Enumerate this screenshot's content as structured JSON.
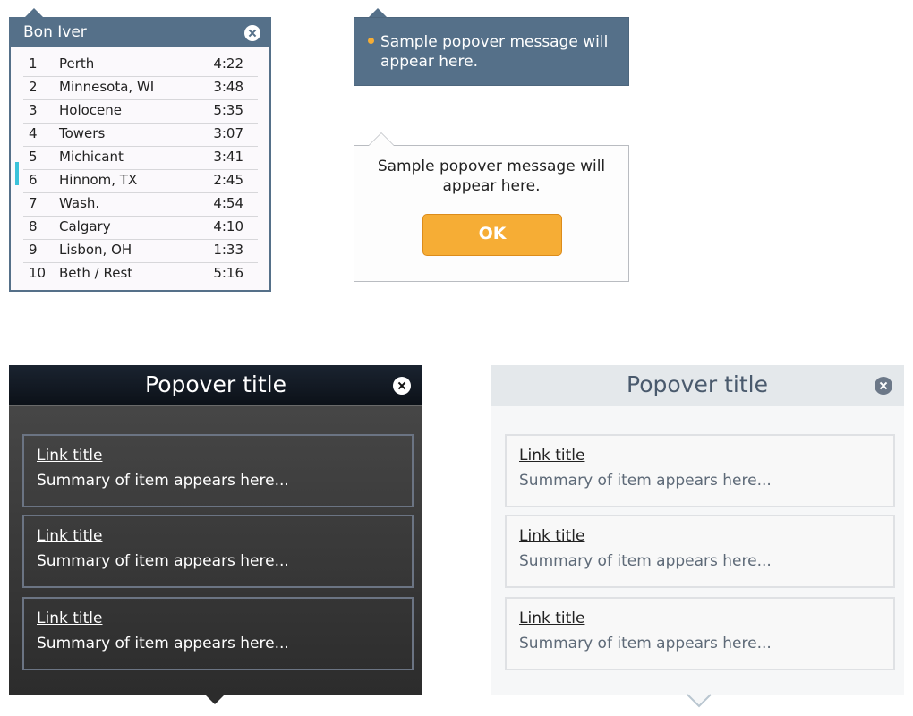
{
  "playlist": {
    "title": "Bon Iver",
    "tracks": [
      {
        "num": "1",
        "name": "Perth",
        "time": "4:22"
      },
      {
        "num": "2",
        "name": "Minnesota, WI",
        "time": "3:48"
      },
      {
        "num": "3",
        "name": "Holocene",
        "time": "5:35"
      },
      {
        "num": "4",
        "name": "Towers",
        "time": "3:07"
      },
      {
        "num": "5",
        "name": "Michicant",
        "time": "3:41"
      },
      {
        "num": "6",
        "name": "Hinnom, TX",
        "time": "2:45"
      },
      {
        "num": "7",
        "name": "Wash.",
        "time": "4:54"
      },
      {
        "num": "8",
        "name": "Calgary",
        "time": "4:10"
      },
      {
        "num": "9",
        "name": "Lisbon, OH",
        "time": "1:33"
      },
      {
        "num": "10",
        "name": "Beth / Rest",
        "time": "5:16"
      }
    ],
    "active_track": "5"
  },
  "blue_popover": {
    "message": "Sample popover message will appear here."
  },
  "white_popover": {
    "message": "Sample popover message will appear here.",
    "ok_label": "OK"
  },
  "dark_popover": {
    "title": "Popover title",
    "items": [
      {
        "link": "Link title",
        "summary": "Summary of item appears here..."
      },
      {
        "link": "Link title",
        "summary": "Summary of item appears here..."
      },
      {
        "link": "Link title",
        "summary": "Summary of item appears here..."
      }
    ]
  },
  "light_popover": {
    "title": "Popover title",
    "items": [
      {
        "link": "Link title",
        "summary": "Summary of item appears here..."
      },
      {
        "link": "Link title",
        "summary": "Summary of item appears here..."
      },
      {
        "link": "Link title",
        "summary": "Summary of item appears here..."
      }
    ]
  },
  "colors": {
    "slate_blue": "#557089",
    "accent_orange": "#f6ad35",
    "active_marker": "#3ac2da",
    "dark_header": "#0c1118",
    "light_header": "#e4e8eb"
  },
  "icons": [
    "close-icon",
    "bullet-dot-icon",
    "caret-up-icon",
    "caret-down-icon"
  ]
}
